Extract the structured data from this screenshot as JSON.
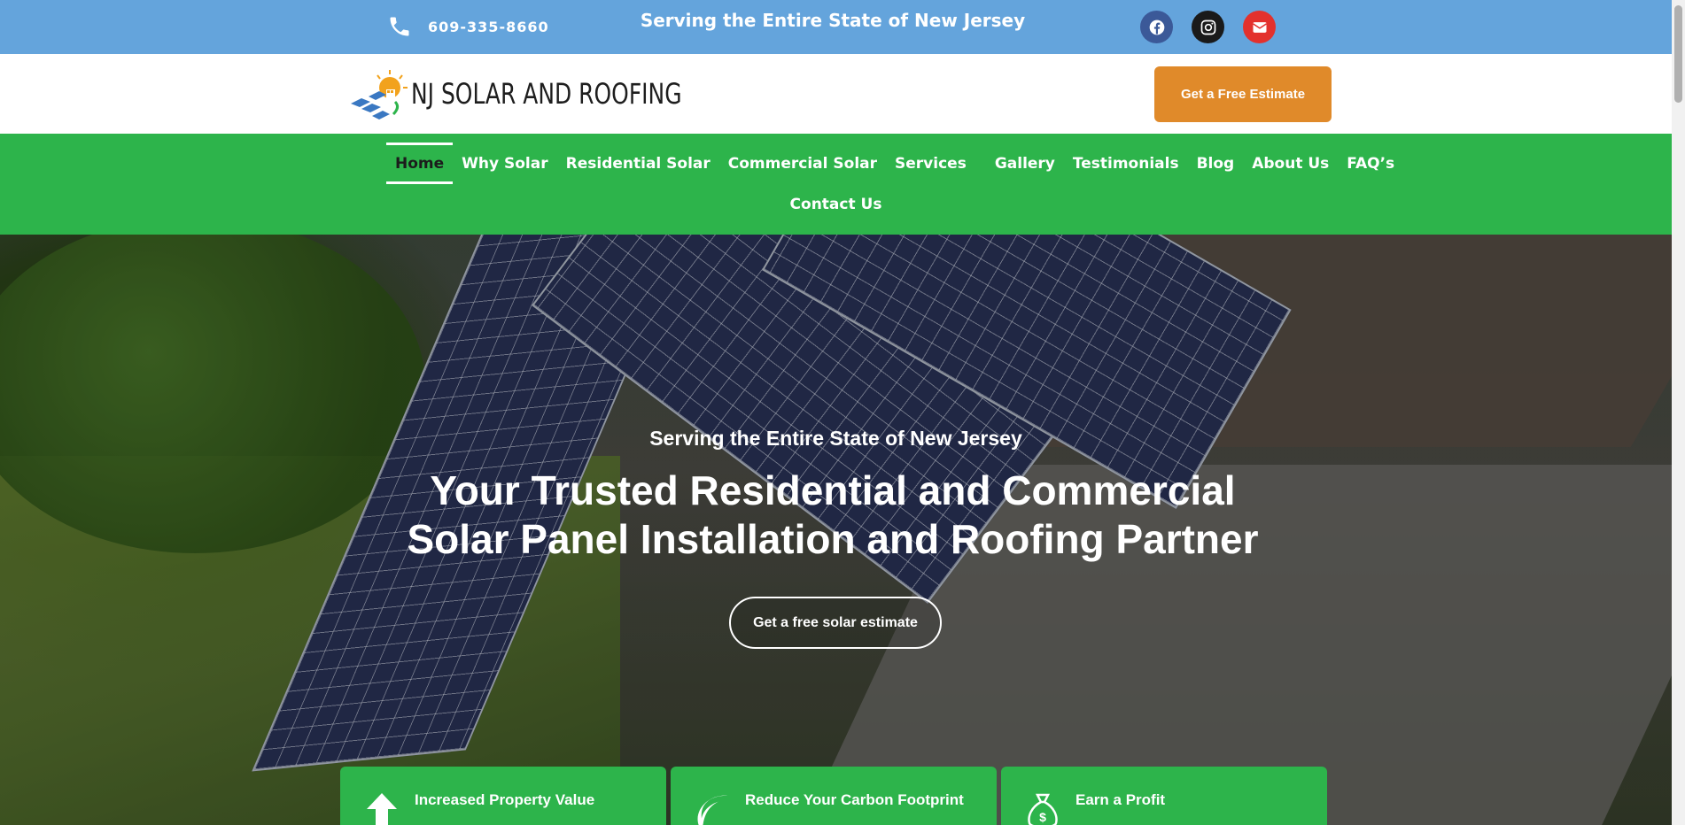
{
  "topbar": {
    "phone": "609-335-8660",
    "tagline": "Serving the Entire State of New Jersey",
    "social": [
      "facebook-icon",
      "instagram-icon",
      "email-icon"
    ]
  },
  "header": {
    "logo_text": "NJ SOLAR AND ROOFING",
    "estimate_button": "Get a Free Estimate"
  },
  "nav": {
    "items": [
      "Home",
      "Why Solar",
      "Residential Solar",
      "Commercial Solar",
      "Services",
      "Gallery",
      "Testimonials",
      "Blog",
      "About Us",
      "FAQ’s",
      "Contact Us"
    ],
    "active": "Home"
  },
  "hero": {
    "subtitle": "Serving the Entire State of New Jersey",
    "title": "Your Trusted Residential and Commercial Solar Panel Installation and Roofing Partner",
    "button": "Get a free solar estimate"
  },
  "features": [
    {
      "label": "Increased Property Value",
      "icon": "arrow-up-icon"
    },
    {
      "label": "Reduce Your Carbon Footprint",
      "icon": "leaf-icon"
    },
    {
      "label": "Earn a Profit",
      "icon": "money-bag-icon"
    }
  ],
  "colors": {
    "topbar": "#64a4dc",
    "nav": "#2db44b",
    "accent": "#e08a2a"
  }
}
